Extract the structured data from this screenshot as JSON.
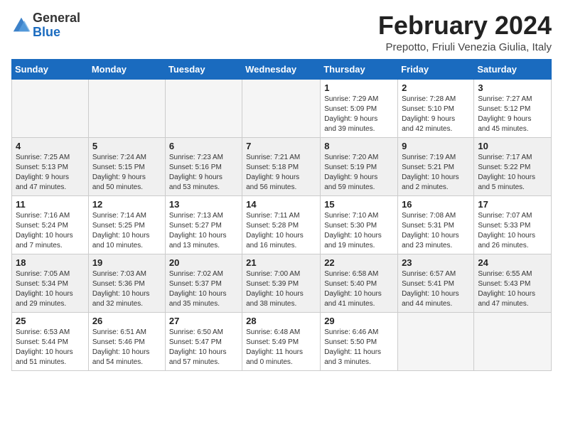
{
  "header": {
    "logo_general": "General",
    "logo_blue": "Blue",
    "month_year": "February 2024",
    "location": "Prepotto, Friuli Venezia Giulia, Italy"
  },
  "days_of_week": [
    "Sunday",
    "Monday",
    "Tuesday",
    "Wednesday",
    "Thursday",
    "Friday",
    "Saturday"
  ],
  "weeks": [
    {
      "shaded": false,
      "days": [
        {
          "number": "",
          "info": "",
          "empty": true
        },
        {
          "number": "",
          "info": "",
          "empty": true
        },
        {
          "number": "",
          "info": "",
          "empty": true
        },
        {
          "number": "",
          "info": "",
          "empty": true
        },
        {
          "number": "1",
          "info": "Sunrise: 7:29 AM\nSunset: 5:09 PM\nDaylight: 9 hours\nand 39 minutes.",
          "empty": false
        },
        {
          "number": "2",
          "info": "Sunrise: 7:28 AM\nSunset: 5:10 PM\nDaylight: 9 hours\nand 42 minutes.",
          "empty": false
        },
        {
          "number": "3",
          "info": "Sunrise: 7:27 AM\nSunset: 5:12 PM\nDaylight: 9 hours\nand 45 minutes.",
          "empty": false
        }
      ]
    },
    {
      "shaded": true,
      "days": [
        {
          "number": "4",
          "info": "Sunrise: 7:25 AM\nSunset: 5:13 PM\nDaylight: 9 hours\nand 47 minutes.",
          "empty": false
        },
        {
          "number": "5",
          "info": "Sunrise: 7:24 AM\nSunset: 5:15 PM\nDaylight: 9 hours\nand 50 minutes.",
          "empty": false
        },
        {
          "number": "6",
          "info": "Sunrise: 7:23 AM\nSunset: 5:16 PM\nDaylight: 9 hours\nand 53 minutes.",
          "empty": false
        },
        {
          "number": "7",
          "info": "Sunrise: 7:21 AM\nSunset: 5:18 PM\nDaylight: 9 hours\nand 56 minutes.",
          "empty": false
        },
        {
          "number": "8",
          "info": "Sunrise: 7:20 AM\nSunset: 5:19 PM\nDaylight: 9 hours\nand 59 minutes.",
          "empty": false
        },
        {
          "number": "9",
          "info": "Sunrise: 7:19 AM\nSunset: 5:21 PM\nDaylight: 10 hours\nand 2 minutes.",
          "empty": false
        },
        {
          "number": "10",
          "info": "Sunrise: 7:17 AM\nSunset: 5:22 PM\nDaylight: 10 hours\nand 5 minutes.",
          "empty": false
        }
      ]
    },
    {
      "shaded": false,
      "days": [
        {
          "number": "11",
          "info": "Sunrise: 7:16 AM\nSunset: 5:24 PM\nDaylight: 10 hours\nand 7 minutes.",
          "empty": false
        },
        {
          "number": "12",
          "info": "Sunrise: 7:14 AM\nSunset: 5:25 PM\nDaylight: 10 hours\nand 10 minutes.",
          "empty": false
        },
        {
          "number": "13",
          "info": "Sunrise: 7:13 AM\nSunset: 5:27 PM\nDaylight: 10 hours\nand 13 minutes.",
          "empty": false
        },
        {
          "number": "14",
          "info": "Sunrise: 7:11 AM\nSunset: 5:28 PM\nDaylight: 10 hours\nand 16 minutes.",
          "empty": false
        },
        {
          "number": "15",
          "info": "Sunrise: 7:10 AM\nSunset: 5:30 PM\nDaylight: 10 hours\nand 19 minutes.",
          "empty": false
        },
        {
          "number": "16",
          "info": "Sunrise: 7:08 AM\nSunset: 5:31 PM\nDaylight: 10 hours\nand 23 minutes.",
          "empty": false
        },
        {
          "number": "17",
          "info": "Sunrise: 7:07 AM\nSunset: 5:33 PM\nDaylight: 10 hours\nand 26 minutes.",
          "empty": false
        }
      ]
    },
    {
      "shaded": true,
      "days": [
        {
          "number": "18",
          "info": "Sunrise: 7:05 AM\nSunset: 5:34 PM\nDaylight: 10 hours\nand 29 minutes.",
          "empty": false
        },
        {
          "number": "19",
          "info": "Sunrise: 7:03 AM\nSunset: 5:36 PM\nDaylight: 10 hours\nand 32 minutes.",
          "empty": false
        },
        {
          "number": "20",
          "info": "Sunrise: 7:02 AM\nSunset: 5:37 PM\nDaylight: 10 hours\nand 35 minutes.",
          "empty": false
        },
        {
          "number": "21",
          "info": "Sunrise: 7:00 AM\nSunset: 5:39 PM\nDaylight: 10 hours\nand 38 minutes.",
          "empty": false
        },
        {
          "number": "22",
          "info": "Sunrise: 6:58 AM\nSunset: 5:40 PM\nDaylight: 10 hours\nand 41 minutes.",
          "empty": false
        },
        {
          "number": "23",
          "info": "Sunrise: 6:57 AM\nSunset: 5:41 PM\nDaylight: 10 hours\nand 44 minutes.",
          "empty": false
        },
        {
          "number": "24",
          "info": "Sunrise: 6:55 AM\nSunset: 5:43 PM\nDaylight: 10 hours\nand 47 minutes.",
          "empty": false
        }
      ]
    },
    {
      "shaded": false,
      "days": [
        {
          "number": "25",
          "info": "Sunrise: 6:53 AM\nSunset: 5:44 PM\nDaylight: 10 hours\nand 51 minutes.",
          "empty": false
        },
        {
          "number": "26",
          "info": "Sunrise: 6:51 AM\nSunset: 5:46 PM\nDaylight: 10 hours\nand 54 minutes.",
          "empty": false
        },
        {
          "number": "27",
          "info": "Sunrise: 6:50 AM\nSunset: 5:47 PM\nDaylight: 10 hours\nand 57 minutes.",
          "empty": false
        },
        {
          "number": "28",
          "info": "Sunrise: 6:48 AM\nSunset: 5:49 PM\nDaylight: 11 hours\nand 0 minutes.",
          "empty": false
        },
        {
          "number": "29",
          "info": "Sunrise: 6:46 AM\nSunset: 5:50 PM\nDaylight: 11 hours\nand 3 minutes.",
          "empty": false
        },
        {
          "number": "",
          "info": "",
          "empty": true
        },
        {
          "number": "",
          "info": "",
          "empty": true
        }
      ]
    }
  ]
}
